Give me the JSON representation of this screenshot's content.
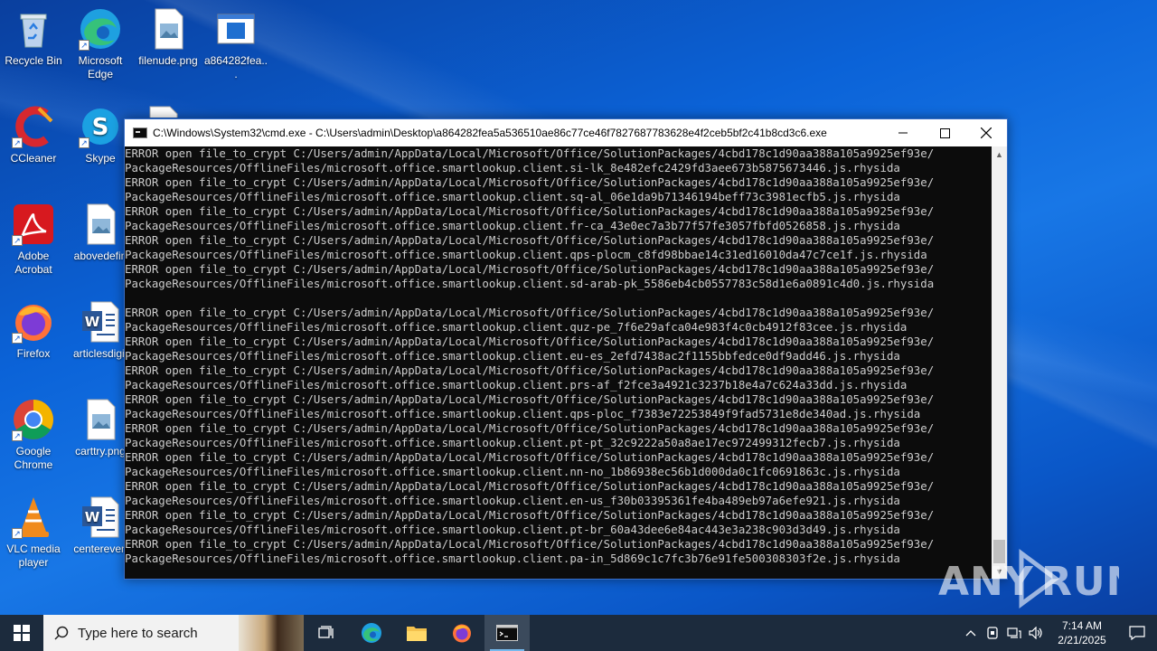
{
  "desktop": {
    "icons": [
      {
        "label": "Recycle Bin"
      },
      {
        "label": "Microsoft Edge"
      },
      {
        "label": "filenude.png"
      },
      {
        "label": "a864282fea..."
      },
      {
        "label": "CCleaner"
      },
      {
        "label": "Skype"
      },
      {
        "label": "Adobe Acrobat"
      },
      {
        "label": "abovedefin"
      },
      {
        "label": "Firefox"
      },
      {
        "label": "articlesdigit"
      },
      {
        "label": "Google Chrome"
      },
      {
        "label": "carttry.png"
      },
      {
        "label": "VLC media player"
      },
      {
        "label": "centereven"
      }
    ]
  },
  "window": {
    "title": "C:\\Windows\\System32\\cmd.exe - C:\\Users\\admin\\Desktop\\a864282fea5a536510ae86c77ce46f7827687783628e4f2ceb5bf2c41b8cd3c6.exe",
    "lines": [
      "ERROR open file_to_crypt C:/Users/admin/AppData/Local/Microsoft/Office/SolutionPackages/4cbd178c1d90aa388a105a9925ef93e/",
      "PackageResources/OfflineFiles/microsoft.office.smartlookup.client.si-lk_8e482efc2429fd3aee673b5875673446.js.rhysida",
      "ERROR open file_to_crypt C:/Users/admin/AppData/Local/Microsoft/Office/SolutionPackages/4cbd178c1d90aa388a105a9925ef93e/",
      "PackageResources/OfflineFiles/microsoft.office.smartlookup.client.sq-al_06e1da9b71346194beff73c3981ecfb5.js.rhysida",
      "ERROR open file_to_crypt C:/Users/admin/AppData/Local/Microsoft/Office/SolutionPackages/4cbd178c1d90aa388a105a9925ef93e/",
      "PackageResources/OfflineFiles/microsoft.office.smartlookup.client.fr-ca_43e0ec7a3b77f57fe3057fbfd0526858.js.rhysida",
      "ERROR open file_to_crypt C:/Users/admin/AppData/Local/Microsoft/Office/SolutionPackages/4cbd178c1d90aa388a105a9925ef93e/",
      "PackageResources/OfflineFiles/microsoft.office.smartlookup.client.qps-plocm_c8fd98bbae14c31ed16010da47c7ce1f.js.rhysida",
      "ERROR open file_to_crypt C:/Users/admin/AppData/Local/Microsoft/Office/SolutionPackages/4cbd178c1d90aa388a105a9925ef93e/",
      "PackageResources/OfflineFiles/microsoft.office.smartlookup.client.sd-arab-pk_5586eb4cb0557783c58d1e6a0891c4d0.js.rhysida",
      "",
      "ERROR open file_to_crypt C:/Users/admin/AppData/Local/Microsoft/Office/SolutionPackages/4cbd178c1d90aa388a105a9925ef93e/",
      "PackageResources/OfflineFiles/microsoft.office.smartlookup.client.quz-pe_7f6e29afca04e983f4c0cb4912f83cee.js.rhysida",
      "ERROR open file_to_crypt C:/Users/admin/AppData/Local/Microsoft/Office/SolutionPackages/4cbd178c1d90aa388a105a9925ef93e/",
      "PackageResources/OfflineFiles/microsoft.office.smartlookup.client.eu-es_2efd7438ac2f1155bbfedce0df9add46.js.rhysida",
      "ERROR open file_to_crypt C:/Users/admin/AppData/Local/Microsoft/Office/SolutionPackages/4cbd178c1d90aa388a105a9925ef93e/",
      "PackageResources/OfflineFiles/microsoft.office.smartlookup.client.prs-af_f2fce3a4921c3237b18e4a7c624a33dd.js.rhysida",
      "ERROR open file_to_crypt C:/Users/admin/AppData/Local/Microsoft/Office/SolutionPackages/4cbd178c1d90aa388a105a9925ef93e/",
      "PackageResources/OfflineFiles/microsoft.office.smartlookup.client.qps-ploc_f7383e72253849f9fad5731e8de340ad.js.rhysida",
      "ERROR open file_to_crypt C:/Users/admin/AppData/Local/Microsoft/Office/SolutionPackages/4cbd178c1d90aa388a105a9925ef93e/",
      "PackageResources/OfflineFiles/microsoft.office.smartlookup.client.pt-pt_32c9222a50a8ae17ec972499312fecb7.js.rhysida",
      "ERROR open file_to_crypt C:/Users/admin/AppData/Local/Microsoft/Office/SolutionPackages/4cbd178c1d90aa388a105a9925ef93e/",
      "PackageResources/OfflineFiles/microsoft.office.smartlookup.client.nn-no_1b86938ec56b1d000da0c1fc0691863c.js.rhysida",
      "ERROR open file_to_crypt C:/Users/admin/AppData/Local/Microsoft/Office/SolutionPackages/4cbd178c1d90aa388a105a9925ef93e/",
      "PackageResources/OfflineFiles/microsoft.office.smartlookup.client.en-us_f30b03395361fe4ba489eb97a6efe921.js.rhysida",
      "ERROR open file_to_crypt C:/Users/admin/AppData/Local/Microsoft/Office/SolutionPackages/4cbd178c1d90aa388a105a9925ef93e/",
      "PackageResources/OfflineFiles/microsoft.office.smartlookup.client.pt-br_60a43dee6e84ac443e3a238c903d3d49.js.rhysida",
      "ERROR open file_to_crypt C:/Users/admin/AppData/Local/Microsoft/Office/SolutionPackages/4cbd178c1d90aa388a105a9925ef93e/",
      "PackageResources/OfflineFiles/microsoft.office.smartlookup.client.pa-in_5d869c1c7fc3b76e91fe500308303f2e.js.rhysida"
    ]
  },
  "taskbar": {
    "search_placeholder": "Type here to search",
    "time": "7:14 AM",
    "date": "2/21/2025"
  },
  "watermark": {
    "text": "ANY RUN"
  }
}
